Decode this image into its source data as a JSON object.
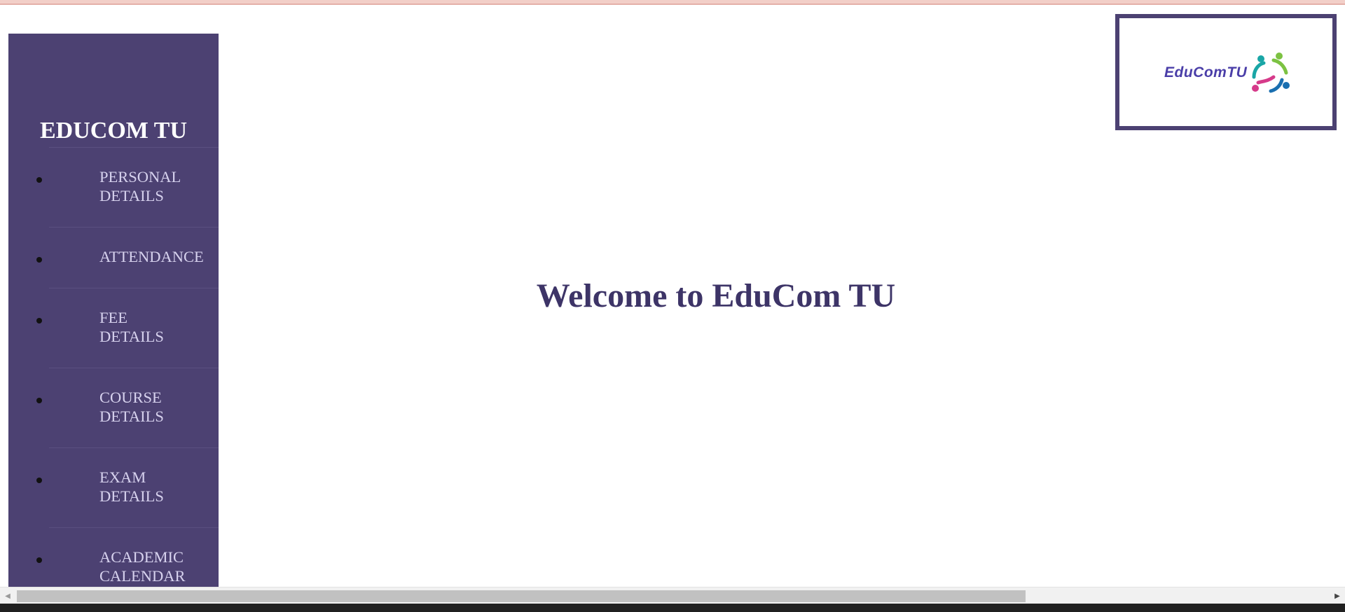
{
  "sidebar": {
    "brand": "EDUCOM TU",
    "items": [
      {
        "label": "PERSONAL\nDETAILS"
      },
      {
        "label": "ATTENDANCE"
      },
      {
        "label": "FEE\nDETAILS"
      },
      {
        "label": "COURSE\nDETAILS"
      },
      {
        "label": "EXAM\nDETAILS"
      },
      {
        "label": "ACADEMIC\nCALENDAR"
      }
    ]
  },
  "main": {
    "welcome": "Welcome to EduCom TU"
  },
  "logo": {
    "text": "EduComTU"
  },
  "colors": {
    "sidebar_bg": "#4c4172",
    "heading": "#3d3467",
    "nav_text": "#d7d2ee",
    "logo_text": "#4a3ea8"
  },
  "scrollbar": {
    "left_arrow": "◀",
    "right_arrow": "▶"
  }
}
